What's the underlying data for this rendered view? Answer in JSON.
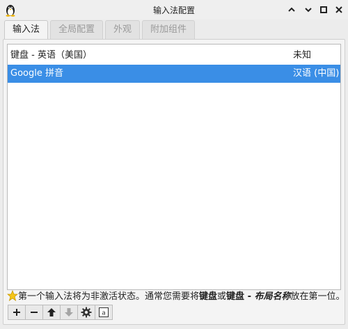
{
  "window": {
    "title": "输入法配置",
    "app_icon": "tux-penguin-icon",
    "controls": [
      "help-icon",
      "minimize-icon",
      "maximize-icon",
      "close-icon"
    ]
  },
  "tabs": [
    {
      "label": "输入法",
      "active": true
    },
    {
      "label": "全局配置",
      "active": false
    },
    {
      "label": "外观",
      "active": false
    },
    {
      "label": "附加组件",
      "active": false
    }
  ],
  "input_methods": [
    {
      "name": "键盘 - 英语（美国）",
      "language": "未知",
      "selected": false
    },
    {
      "name": "Google 拼音",
      "language": "汉语 (中国)",
      "selected": true
    }
  ],
  "hint": {
    "icon": "star-icon",
    "prefix": "第一个输入法将为非激活状态。通常您需要将",
    "bold1": "键盘",
    "middle": "或",
    "bold2": "键盘",
    "dash": " - ",
    "italic": "布局名称",
    "suffix": "放在第一位。"
  },
  "toolbar": {
    "buttons": [
      "add-icon",
      "remove-icon",
      "move-up-icon",
      "move-down-icon",
      "configure-gear-icon",
      "keyboard-layout-icon"
    ]
  },
  "colors": {
    "selection": "#3a8ee6",
    "window_bg": "#ececec"
  }
}
